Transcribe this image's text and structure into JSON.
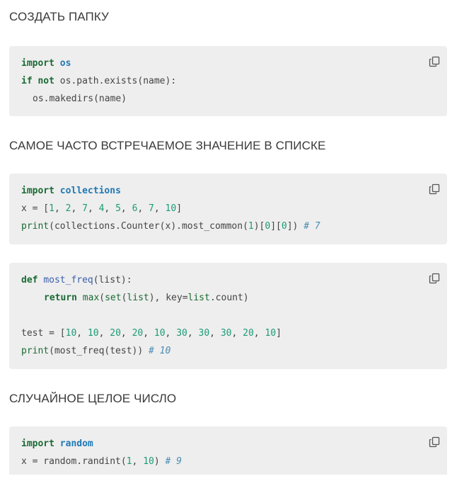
{
  "headings": {
    "create_folder": "СОЗДАТЬ ПАПКУ",
    "most_frequent": "САМОЕ ЧАСТО ВСТРЕЧАЕМОЕ ЗНАЧЕНИЕ В СПИСКЕ",
    "random_int": "СЛУЧАЙНОЕ ЦЕЛОЕ ЧИСЛО"
  },
  "copy_icon": "copy-icon",
  "colors": {
    "keyword": "#1a6b34",
    "module": "#1f79b5",
    "number": "#1c9b77",
    "comment": "#4b8db3",
    "block_bg": "#eeeeee"
  },
  "code": {
    "b1": {
      "l1": [
        "import",
        "os"
      ],
      "l2": [
        "if",
        "not",
        "os.path.exists(name):"
      ],
      "l3": [
        "os.makedirs(name)"
      ]
    },
    "b2": {
      "l1": [
        "import",
        "collections"
      ],
      "l2": [
        "x",
        " = [",
        "1",
        ", ",
        "2",
        ", ",
        "7",
        ", ",
        "4",
        ", ",
        "5",
        ", ",
        "6",
        ", ",
        "7",
        ", ",
        "10",
        "]"
      ],
      "l3": [
        "print",
        "(collections.Counter(x).most_common(",
        "1",
        ")[",
        "0",
        "][",
        "0",
        "])",
        "# 7"
      ]
    },
    "b3": {
      "l1": [
        "def",
        "most_freq",
        "(list):"
      ],
      "l2": [
        "return",
        "max",
        "(",
        "set",
        "(",
        "list",
        "), key=",
        "list",
        ".count)"
      ],
      "l3": [
        "test = [",
        "10",
        ", ",
        "10",
        ", ",
        "20",
        ", ",
        "20",
        ", ",
        "10",
        ", ",
        "30",
        ", ",
        "30",
        ", ",
        "30",
        ", ",
        "20",
        ", ",
        "10",
        "]"
      ],
      "l4": [
        "print",
        "(most_freq(test))",
        "# 10"
      ]
    },
    "b4": {
      "l1": [
        "import",
        "random"
      ],
      "l2": [
        "x = random.randint(",
        "1",
        ", ",
        "10",
        ")",
        "# 9"
      ]
    }
  }
}
